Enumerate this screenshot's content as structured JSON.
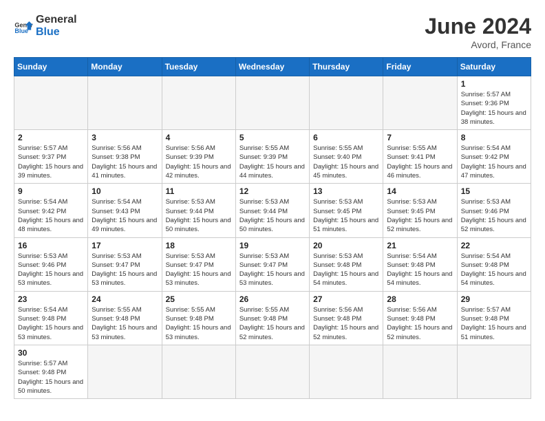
{
  "header": {
    "logo_general": "General",
    "logo_blue": "Blue",
    "month_title": "June 2024",
    "subtitle": "Avord, France"
  },
  "days_of_week": [
    "Sunday",
    "Monday",
    "Tuesday",
    "Wednesday",
    "Thursday",
    "Friday",
    "Saturday"
  ],
  "weeks": [
    [
      {
        "day": "",
        "info": ""
      },
      {
        "day": "",
        "info": ""
      },
      {
        "day": "",
        "info": ""
      },
      {
        "day": "",
        "info": ""
      },
      {
        "day": "",
        "info": ""
      },
      {
        "day": "",
        "info": ""
      },
      {
        "day": "1",
        "info": "Sunrise: 5:57 AM\nSunset: 9:36 PM\nDaylight: 15 hours and 38 minutes."
      }
    ],
    [
      {
        "day": "2",
        "info": "Sunrise: 5:57 AM\nSunset: 9:37 PM\nDaylight: 15 hours and 39 minutes."
      },
      {
        "day": "3",
        "info": "Sunrise: 5:56 AM\nSunset: 9:38 PM\nDaylight: 15 hours and 41 minutes."
      },
      {
        "day": "4",
        "info": "Sunrise: 5:56 AM\nSunset: 9:39 PM\nDaylight: 15 hours and 42 minutes."
      },
      {
        "day": "5",
        "info": "Sunrise: 5:55 AM\nSunset: 9:39 PM\nDaylight: 15 hours and 44 minutes."
      },
      {
        "day": "6",
        "info": "Sunrise: 5:55 AM\nSunset: 9:40 PM\nDaylight: 15 hours and 45 minutes."
      },
      {
        "day": "7",
        "info": "Sunrise: 5:55 AM\nSunset: 9:41 PM\nDaylight: 15 hours and 46 minutes."
      },
      {
        "day": "8",
        "info": "Sunrise: 5:54 AM\nSunset: 9:42 PM\nDaylight: 15 hours and 47 minutes."
      }
    ],
    [
      {
        "day": "9",
        "info": "Sunrise: 5:54 AM\nSunset: 9:42 PM\nDaylight: 15 hours and 48 minutes."
      },
      {
        "day": "10",
        "info": "Sunrise: 5:54 AM\nSunset: 9:43 PM\nDaylight: 15 hours and 49 minutes."
      },
      {
        "day": "11",
        "info": "Sunrise: 5:53 AM\nSunset: 9:44 PM\nDaylight: 15 hours and 50 minutes."
      },
      {
        "day": "12",
        "info": "Sunrise: 5:53 AM\nSunset: 9:44 PM\nDaylight: 15 hours and 50 minutes."
      },
      {
        "day": "13",
        "info": "Sunrise: 5:53 AM\nSunset: 9:45 PM\nDaylight: 15 hours and 51 minutes."
      },
      {
        "day": "14",
        "info": "Sunrise: 5:53 AM\nSunset: 9:45 PM\nDaylight: 15 hours and 52 minutes."
      },
      {
        "day": "15",
        "info": "Sunrise: 5:53 AM\nSunset: 9:46 PM\nDaylight: 15 hours and 52 minutes."
      }
    ],
    [
      {
        "day": "16",
        "info": "Sunrise: 5:53 AM\nSunset: 9:46 PM\nDaylight: 15 hours and 53 minutes."
      },
      {
        "day": "17",
        "info": "Sunrise: 5:53 AM\nSunset: 9:47 PM\nDaylight: 15 hours and 53 minutes."
      },
      {
        "day": "18",
        "info": "Sunrise: 5:53 AM\nSunset: 9:47 PM\nDaylight: 15 hours and 53 minutes."
      },
      {
        "day": "19",
        "info": "Sunrise: 5:53 AM\nSunset: 9:47 PM\nDaylight: 15 hours and 53 minutes."
      },
      {
        "day": "20",
        "info": "Sunrise: 5:53 AM\nSunset: 9:48 PM\nDaylight: 15 hours and 54 minutes."
      },
      {
        "day": "21",
        "info": "Sunrise: 5:54 AM\nSunset: 9:48 PM\nDaylight: 15 hours and 54 minutes."
      },
      {
        "day": "22",
        "info": "Sunrise: 5:54 AM\nSunset: 9:48 PM\nDaylight: 15 hours and 54 minutes."
      }
    ],
    [
      {
        "day": "23",
        "info": "Sunrise: 5:54 AM\nSunset: 9:48 PM\nDaylight: 15 hours and 53 minutes."
      },
      {
        "day": "24",
        "info": "Sunrise: 5:55 AM\nSunset: 9:48 PM\nDaylight: 15 hours and 53 minutes."
      },
      {
        "day": "25",
        "info": "Sunrise: 5:55 AM\nSunset: 9:48 PM\nDaylight: 15 hours and 53 minutes."
      },
      {
        "day": "26",
        "info": "Sunrise: 5:55 AM\nSunset: 9:48 PM\nDaylight: 15 hours and 52 minutes."
      },
      {
        "day": "27",
        "info": "Sunrise: 5:56 AM\nSunset: 9:48 PM\nDaylight: 15 hours and 52 minutes."
      },
      {
        "day": "28",
        "info": "Sunrise: 5:56 AM\nSunset: 9:48 PM\nDaylight: 15 hours and 52 minutes."
      },
      {
        "day": "29",
        "info": "Sunrise: 5:57 AM\nSunset: 9:48 PM\nDaylight: 15 hours and 51 minutes."
      }
    ],
    [
      {
        "day": "30",
        "info": "Sunrise: 5:57 AM\nSunset: 9:48 PM\nDaylight: 15 hours and 50 minutes."
      },
      {
        "day": "",
        "info": ""
      },
      {
        "day": "",
        "info": ""
      },
      {
        "day": "",
        "info": ""
      },
      {
        "day": "",
        "info": ""
      },
      {
        "day": "",
        "info": ""
      },
      {
        "day": "",
        "info": ""
      }
    ]
  ]
}
